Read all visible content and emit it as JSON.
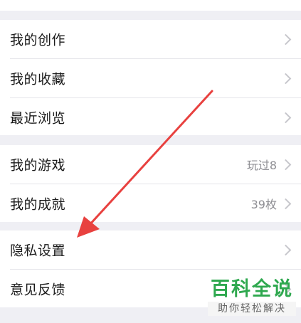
{
  "menu": {
    "group1": [
      {
        "label": "我的创作"
      },
      {
        "label": "我的收藏"
      },
      {
        "label": "最近浏览"
      }
    ],
    "group2": [
      {
        "label": "我的游戏",
        "value": "玩过8"
      },
      {
        "label": "我的成就",
        "value": "39枚"
      }
    ],
    "group3": [
      {
        "label": "隐私设置"
      },
      {
        "label": "意见反馈"
      }
    ]
  },
  "watermark": {
    "title": "百科全说",
    "subtitle": "助你轻松解决"
  },
  "colors": {
    "background": "#efeff4",
    "row": "#ffffff",
    "arrow": "#e8413f",
    "watermark": "#2fa84f"
  },
  "icons": [
    "chevron-right-icon"
  ]
}
